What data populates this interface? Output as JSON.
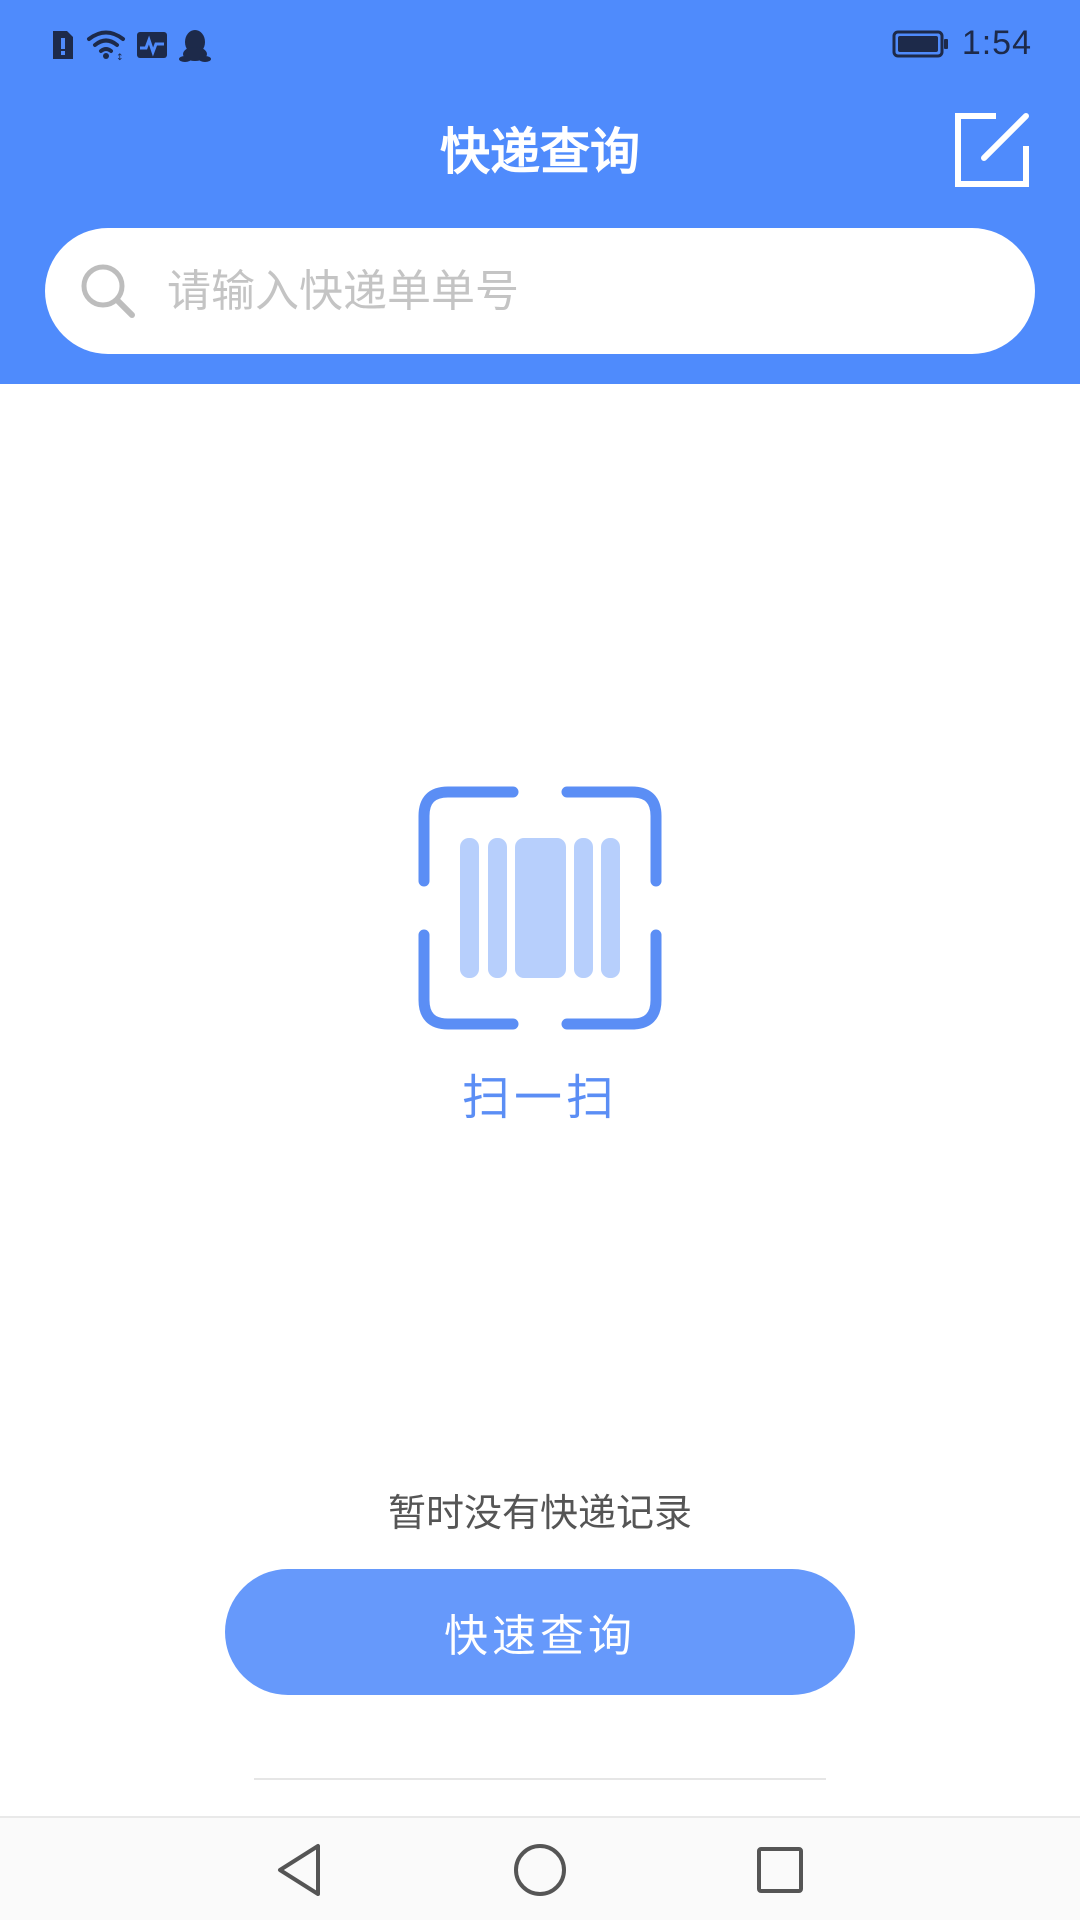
{
  "status_bar": {
    "time": "1:54",
    "icons": [
      "sim-icon",
      "wifi-icon",
      "activity-icon",
      "qq-icon",
      "battery-icon"
    ]
  },
  "header": {
    "title": "快递查询",
    "edit_icon": "edit-icon",
    "background_color": "#4f8bfc"
  },
  "search": {
    "placeholder": "请输入快递单单号",
    "value": "",
    "icon": "search-icon"
  },
  "scan": {
    "label": "扫一扫",
    "icon": "barcode-scan-icon",
    "accent_color": "#5b8ef5"
  },
  "empty_state": {
    "text": "暂时没有快递记录"
  },
  "query_button": {
    "label": "快速查询",
    "color": "#6699fb"
  },
  "system_nav": {
    "buttons": [
      "back-icon",
      "home-icon",
      "recents-icon"
    ]
  }
}
